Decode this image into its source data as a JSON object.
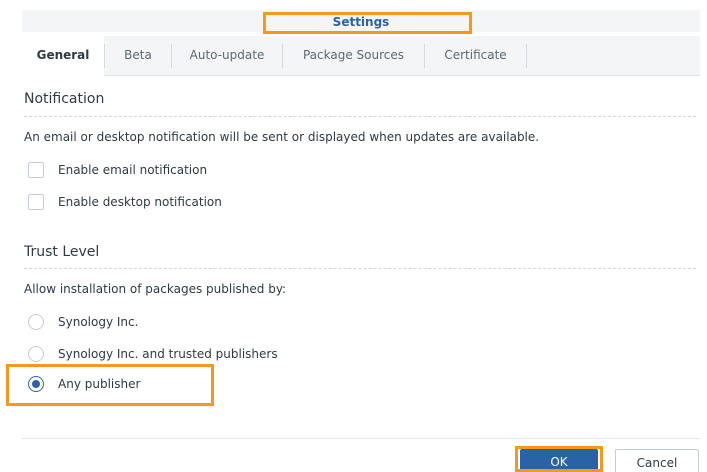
{
  "window": {
    "title": "Settings"
  },
  "tabs": [
    {
      "label": "General",
      "active": true
    },
    {
      "label": "Beta",
      "active": false
    },
    {
      "label": "Auto-update",
      "active": false
    },
    {
      "label": "Package Sources",
      "active": false
    },
    {
      "label": "Certificate",
      "active": false
    }
  ],
  "notification": {
    "heading": "Notification",
    "description": "An email or desktop notification will be sent or displayed when updates are available.",
    "options": [
      {
        "label": "Enable email notification",
        "checked": false
      },
      {
        "label": "Enable desktop notification",
        "checked": false
      }
    ]
  },
  "trust": {
    "heading": "Trust Level",
    "description": "Allow installation of packages published by:",
    "options": [
      {
        "label": "Synology Inc.",
        "selected": false
      },
      {
        "label": "Synology Inc. and trusted publishers",
        "selected": false
      },
      {
        "label": "Any publisher",
        "selected": true
      }
    ]
  },
  "footer": {
    "ok_label": "OK",
    "cancel_label": "Cancel"
  },
  "colors": {
    "accent": "#2a62a6",
    "highlight": "#f39a1e"
  }
}
